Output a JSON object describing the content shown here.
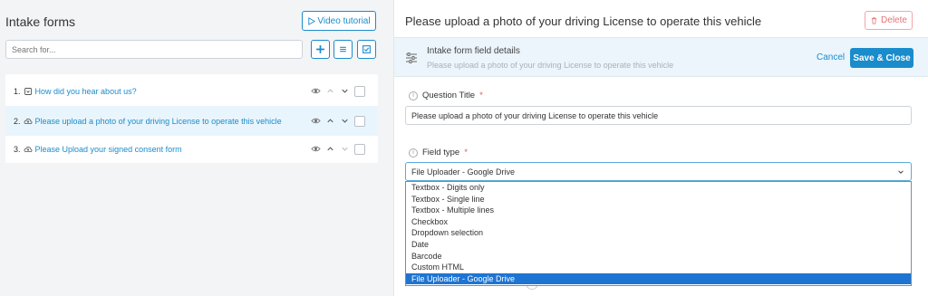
{
  "left": {
    "title": "Intake forms",
    "video_label": "Video tutorial",
    "search_placeholder": "Search for...",
    "items": [
      {
        "num": "1.",
        "label": "How did you hear about us?",
        "icon": "dropdown-icon",
        "selected": false
      },
      {
        "num": "2.",
        "label": "Please upload a photo of your driving License to operate this vehicle",
        "icon": "cloud-upload-icon",
        "selected": true
      },
      {
        "num": "3.",
        "label": "Please Upload your signed consent form",
        "icon": "cloud-upload-icon",
        "selected": false
      }
    ]
  },
  "right": {
    "title": "Please upload a photo of your driving License to operate this vehicle",
    "delete_label": "Delete",
    "subhead_title": "Intake form field details",
    "subhead_sub": "Please upload a photo of your driving License to operate this vehicle",
    "cancel_label": "Cancel",
    "save_label": "Save & Close",
    "question_label": "Question Title",
    "question_value": "Please upload a photo of your driving License to operate this vehicle",
    "field_type_label": "Field type",
    "field_type_value": "File Uploader - Google Drive",
    "required_mark": "*",
    "info_mark": "i",
    "options": [
      "Textbox - Digits only",
      "Textbox - Single line",
      "Textbox - Multiple lines",
      "Checkbox",
      "Dropdown selection",
      "Date",
      "Barcode",
      "Custom HTML",
      "File Uploader - Google Drive"
    ]
  },
  "colors": {
    "accent": "#1a8ccc",
    "danger": "#e57373",
    "selected_option": "#1e74d2"
  }
}
